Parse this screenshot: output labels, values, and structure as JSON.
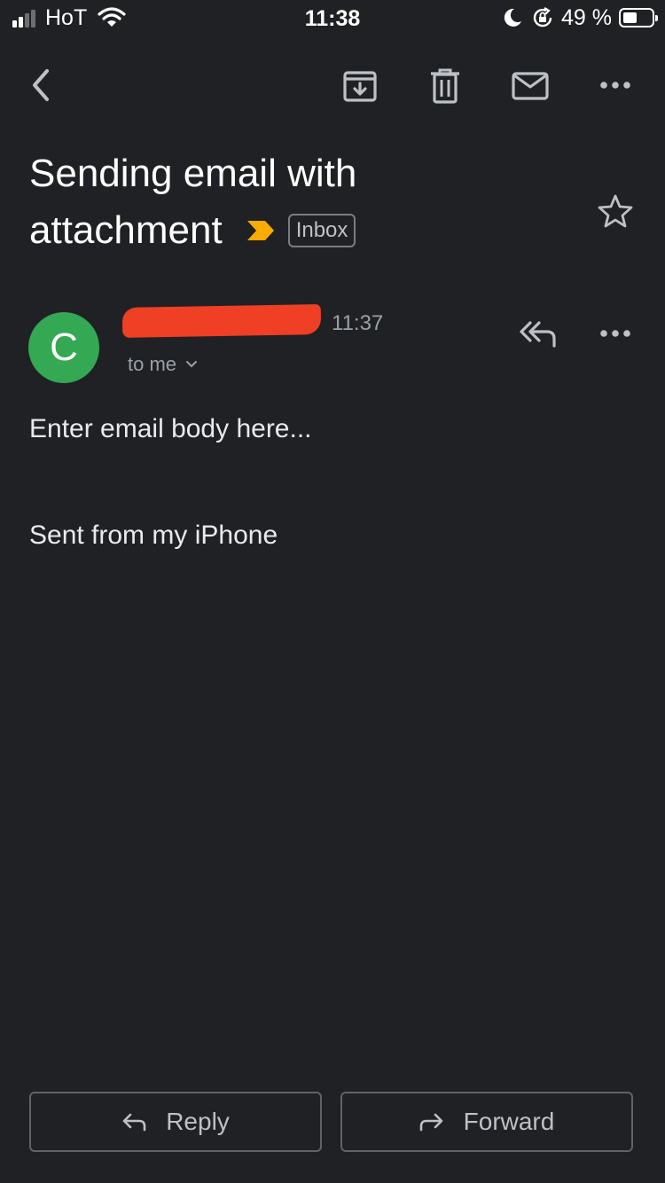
{
  "status_bar": {
    "carrier": "HoT",
    "time": "11:38",
    "battery_percent": "49 %",
    "battery_level": 0.49,
    "signal_bars": 2
  },
  "toolbar": {
    "icons": [
      "back-arrow-icon",
      "archive-icon",
      "trash-icon",
      "mark-unread-mail-icon",
      "more-horizontal-icon"
    ]
  },
  "email": {
    "subject_line1": "Sending email with",
    "subject_line2": "attachment",
    "label": "Inbox",
    "sender_initial": "C",
    "time": "11:37",
    "recipient": "to me",
    "body_line1": "Enter email body here...",
    "body_line2": "Sent from my iPhone"
  },
  "actions": {
    "reply_label": "Reply",
    "forward_label": "Forward"
  },
  "colors": {
    "background": "#202124",
    "avatar": "#34a853",
    "importance_marker": "#f9ab00",
    "redaction": "#ef3f24",
    "text_secondary": "#9aa0a6"
  }
}
